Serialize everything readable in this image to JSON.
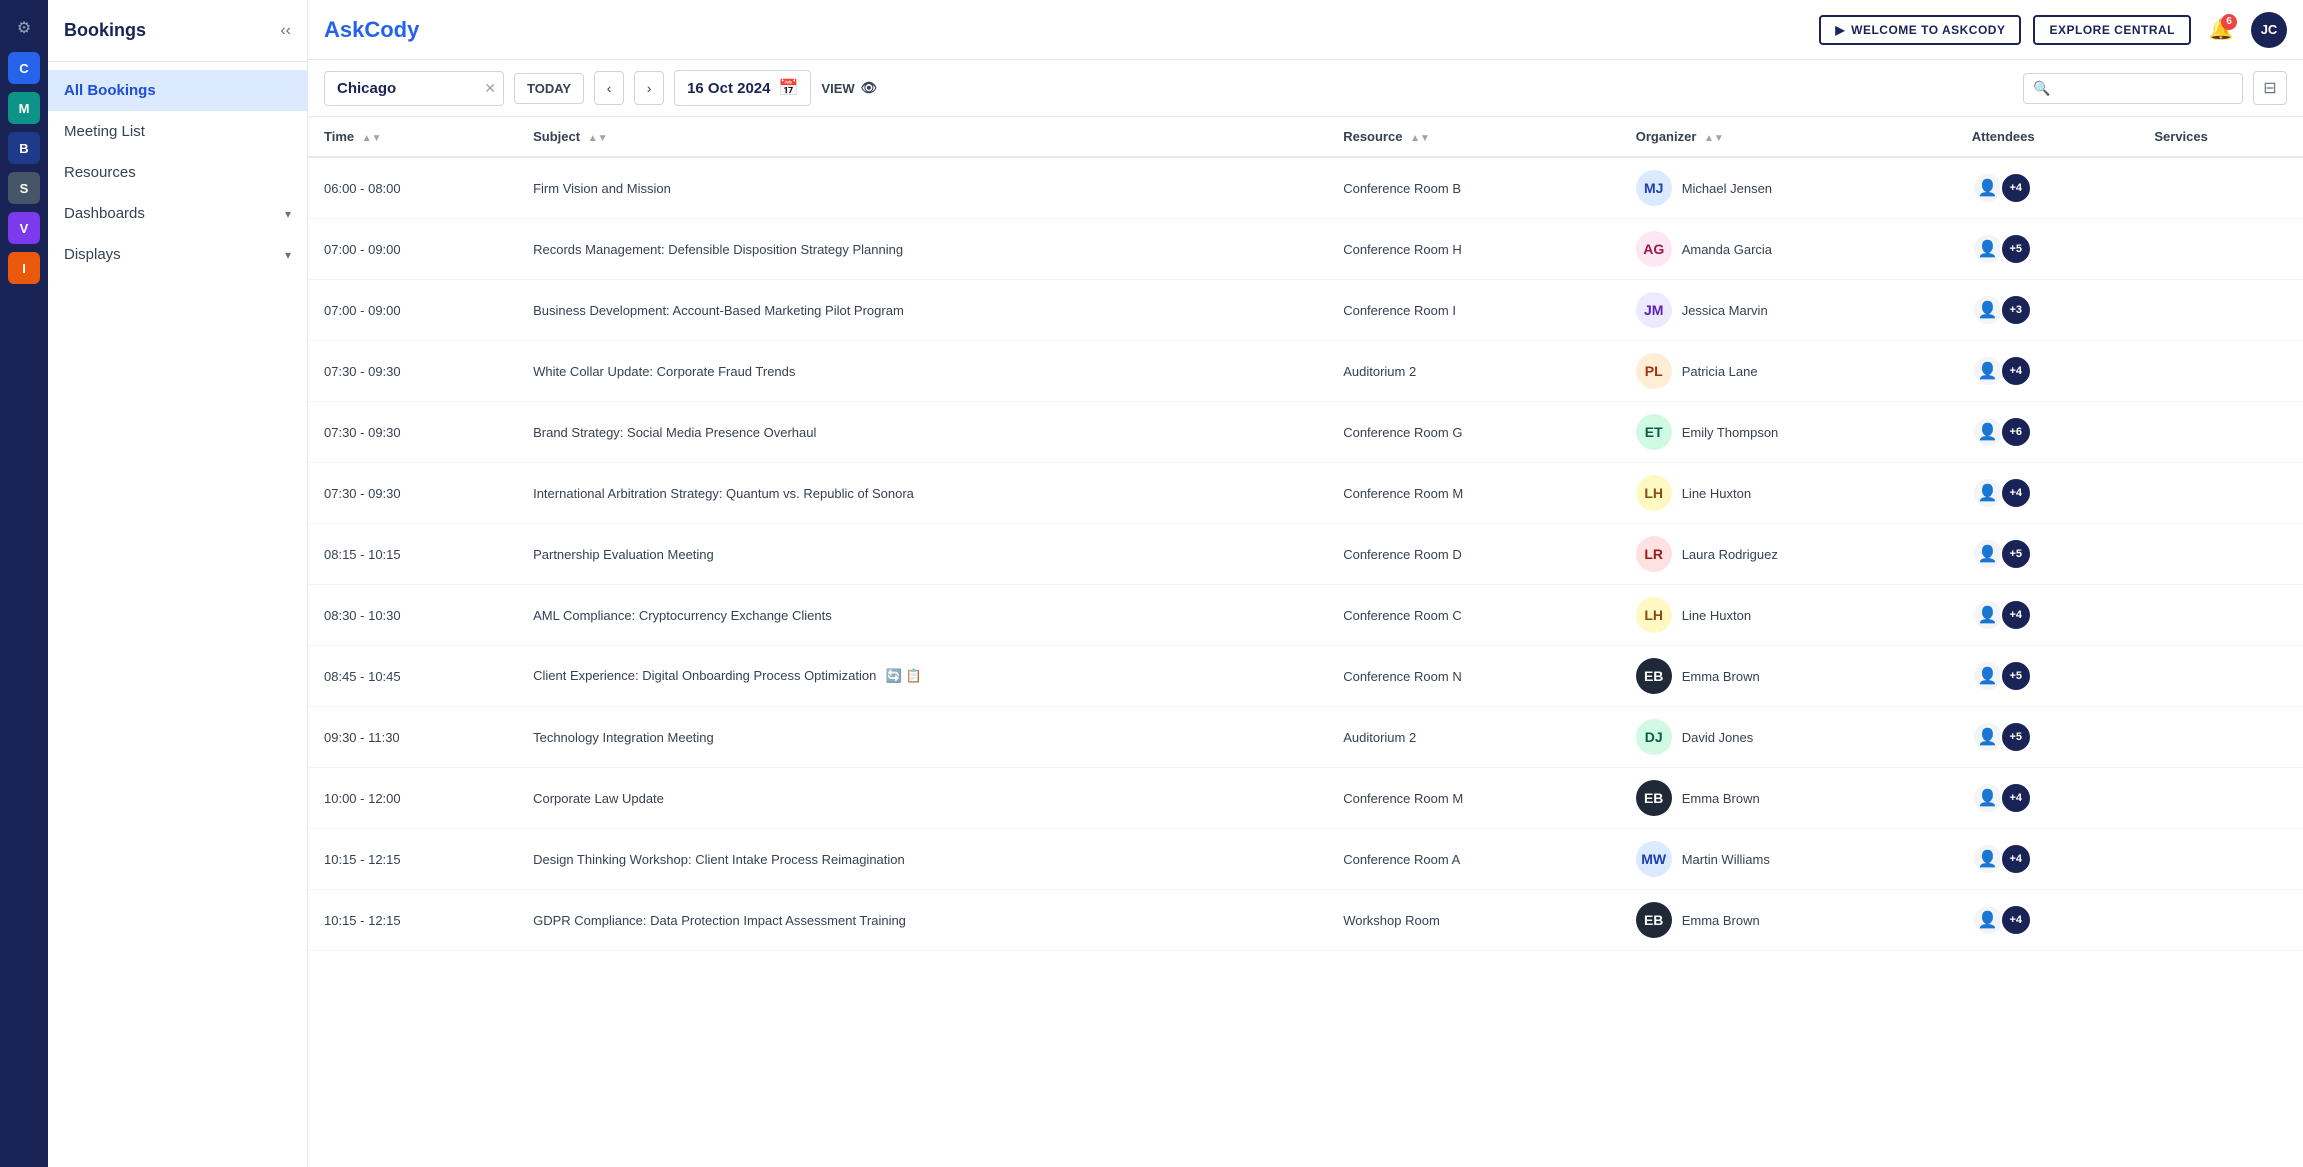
{
  "app": {
    "name": "AskCody",
    "name_part1": "Ask",
    "name_part2": "Cody"
  },
  "topbar": {
    "welcome_label": "WELCOME TO ASKCODY",
    "explore_label": "EXPLORE CENTRAL",
    "notification_count": "6",
    "user_initials": "JC"
  },
  "icon_bar": {
    "icons": [
      {
        "id": "C",
        "color": "blue",
        "label": "C"
      },
      {
        "id": "M",
        "color": "teal",
        "label": "M"
      },
      {
        "id": "B",
        "color": "navy",
        "label": "B"
      },
      {
        "id": "S",
        "color": "slate",
        "label": "S"
      },
      {
        "id": "V",
        "color": "violet",
        "label": "V"
      },
      {
        "id": "I",
        "color": "orange",
        "label": "I"
      }
    ]
  },
  "sidebar": {
    "title": "Bookings",
    "items": [
      {
        "label": "All Bookings",
        "active": true
      },
      {
        "label": "Meeting List",
        "active": false
      },
      {
        "label": "Resources",
        "active": false
      },
      {
        "label": "Dashboards",
        "active": false,
        "expandable": true
      },
      {
        "label": "Displays",
        "active": false,
        "expandable": true
      }
    ]
  },
  "filter_bar": {
    "location": "Chicago",
    "today_label": "TODAY",
    "date": "16 Oct 2024",
    "view_label": "VIEW",
    "search_placeholder": ""
  },
  "table": {
    "columns": [
      "Time",
      "Subject",
      "Resource",
      "Organizer",
      "Attendees",
      "Services"
    ],
    "rows": [
      {
        "time": "06:00 - 08:00",
        "subject": "Firm Vision and Mission",
        "resource": "Conference Room B",
        "organizer": "Michael Jensen",
        "organizer_initials": "MJ",
        "av_class": "av-blue",
        "attendee_count": "+4",
        "icons": ""
      },
      {
        "time": "07:00 - 09:00",
        "subject": "Records Management: Defensible Disposition Strategy Planning",
        "resource": "Conference Room H",
        "organizer": "Amanda Garcia",
        "organizer_initials": "AG",
        "av_class": "av-pink",
        "attendee_count": "+5",
        "icons": ""
      },
      {
        "time": "07:00 - 09:00",
        "subject": "Business Development: Account-Based Marketing Pilot Program",
        "resource": "Conference Room I",
        "organizer": "Jessica Marvin",
        "organizer_initials": "JM",
        "av_class": "av-purple",
        "attendee_count": "+3",
        "icons": ""
      },
      {
        "time": "07:30 - 09:30",
        "subject": "White Collar Update: Corporate Fraud Trends",
        "resource": "Auditorium 2",
        "organizer": "Patricia Lane",
        "organizer_initials": "PL",
        "av_class": "av-orange",
        "attendee_count": "+4",
        "icons": ""
      },
      {
        "time": "07:30 - 09:30",
        "subject": "Brand Strategy: Social Media Presence Overhaul",
        "resource": "Conference Room G",
        "organizer": "Emily Thompson",
        "organizer_initials": "ET",
        "av_class": "av-green",
        "attendee_count": "+6",
        "icons": ""
      },
      {
        "time": "07:30 - 09:30",
        "subject": "International Arbitration Strategy: Quantum vs. Republic of Sonora",
        "resource": "Conference Room M",
        "organizer": "Line Huxton",
        "organizer_initials": "LH",
        "av_class": "av-yellow",
        "attendee_count": "+4",
        "icons": ""
      },
      {
        "time": "08:15 - 10:15",
        "subject": "Partnership Evaluation Meeting",
        "resource": "Conference Room D",
        "organizer": "Laura Rodriguez",
        "organizer_initials": "LR",
        "av_class": "av-red",
        "attendee_count": "+5",
        "icons": ""
      },
      {
        "time": "08:30 - 10:30",
        "subject": "AML Compliance: Cryptocurrency Exchange Clients",
        "resource": "Conference Room C",
        "organizer": "Line Huxton",
        "organizer_initials": "LH",
        "av_class": "av-yellow",
        "attendee_count": "+4",
        "icons": ""
      },
      {
        "time": "08:45 - 10:45",
        "subject": "Client Experience: Digital Onboarding Process Optimization",
        "resource": "Conference Room N",
        "organizer": "Emma Brown",
        "organizer_initials": "EB",
        "av_class": "av-dark",
        "attendee_count": "+5",
        "icons": "🔄 📋"
      },
      {
        "time": "09:30 - 11:30",
        "subject": "Technology Integration Meeting",
        "resource": "Auditorium 2",
        "organizer": "David Jones",
        "organizer_initials": "DJ",
        "av_class": "av-green",
        "attendee_count": "+5",
        "icons": ""
      },
      {
        "time": "10:00 - 12:00",
        "subject": "Corporate Law Update",
        "resource": "Conference Room M",
        "organizer": "Emma Brown",
        "organizer_initials": "EB",
        "av_class": "av-dark",
        "attendee_count": "+4",
        "icons": ""
      },
      {
        "time": "10:15 - 12:15",
        "subject": "Design Thinking Workshop: Client Intake Process Reimagination",
        "resource": "Conference Room A",
        "organizer": "Martin Williams",
        "organizer_initials": "MW",
        "av_class": "av-blue",
        "attendee_count": "+4",
        "icons": ""
      },
      {
        "time": "10:15 - 12:15",
        "subject": "GDPR Compliance: Data Protection Impact Assessment Training",
        "resource": "Workshop Room",
        "organizer": "Emma Brown",
        "organizer_initials": "EB",
        "av_class": "av-dark",
        "attendee_count": "+4",
        "icons": ""
      }
    ]
  }
}
